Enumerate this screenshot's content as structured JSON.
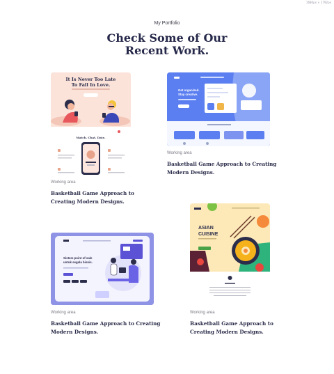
{
  "size_note": "1680px × 1792px",
  "section": {
    "eyebrow": "My Portfolio",
    "heading_line1": "Check Some of Our",
    "heading_line2": "Recent Work."
  },
  "cards": [
    {
      "category": "Working area",
      "title_line1": "Basketball Game Approach to",
      "title_line2": "Creating Modern Designs.",
      "thumb": {
        "headline_line1": "It Is Never Too Late",
        "headline_line2": "To Fall In Love.",
        "sub_heading": "Match. Chat. Date."
      }
    },
    {
      "category": "Working area",
      "title_line1": "Basketball Game Approach to Creating",
      "title_line2": "Modern Designs.",
      "thumb": {
        "headline_line1": "Get organized.",
        "headline_line2": "Stay creative."
      }
    },
    {
      "category": "Working area",
      "title_line1": "Basketball Game Approach to Creating",
      "title_line2": "Modern Designs.",
      "thumb": {
        "headline_line1": "Sistem point of sale",
        "headline_line2": "untuk segala bisnis."
      }
    },
    {
      "category": "Working area",
      "title_line1": "Basketball Game Approach to",
      "title_line2": "Creating Modern Designs.",
      "thumb": {
        "headline_line1": "ASIAN",
        "headline_line2": "CUISINE"
      }
    }
  ],
  "colors": {
    "heading": "#27294a",
    "dating_bg": "#fbe3da",
    "dash_blue": "#5b7ff0",
    "pos_purple": "#8f93e6",
    "asian_yellow": "#fde9b8"
  }
}
